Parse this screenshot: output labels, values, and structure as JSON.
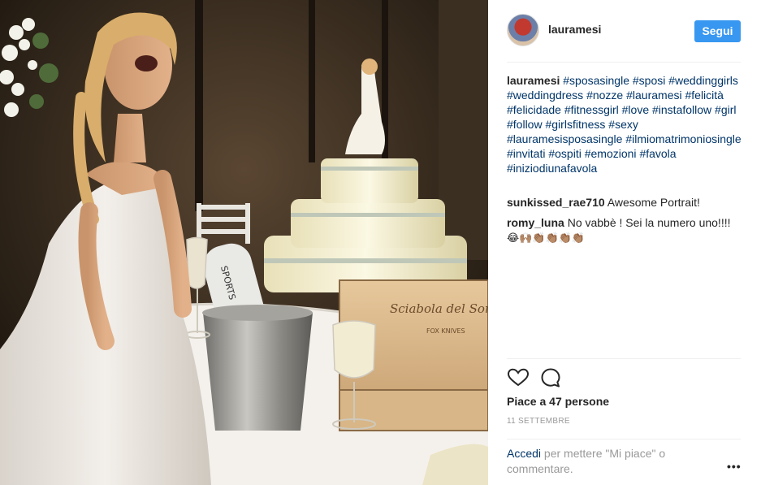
{
  "post": {
    "username": "lauramesi",
    "follow_label": "Segui",
    "caption_user": "lauramesi",
    "caption_hashtags": [
      "#sposasingle",
      "#sposi",
      "#weddinggirls",
      "#weddingdress",
      "#nozze",
      "#lauramesi",
      "#felicità",
      "#felicidade",
      "#fitnessgirl",
      "#love",
      "#instafollow",
      "#girl",
      "#follow",
      "#girlsfitness",
      "#sexy",
      "#lauramesisposasingle",
      "#ilmiomatrimoniosingle",
      "#invitati",
      "#ospiti",
      "#emozioni",
      "#favola",
      "#iniziodiunafavola"
    ],
    "comments": [
      {
        "user": "sunkissed_rae710",
        "text": "Awesome Portrait!"
      },
      {
        "user": "romy_luna",
        "text": "No vabbè ! Sei la numero uno!!!!",
        "emoji": "😂🙌🏽👏🏽👏🏽👏🏽👏🏽"
      }
    ],
    "likes": "Piace a 47 persone",
    "date": "11 SETTEMBRE",
    "login_link": "Accedi",
    "login_text": " per mettere \"Mi piace\" o commentare.",
    "more_label": "•••"
  },
  "photo": {
    "box_text_1": "Sciabola del Sommelier",
    "box_text_2": "FOX KNIVES",
    "bottle_label": "SPORTS"
  },
  "icons": {
    "heart": "heart-icon",
    "comment": "comment-icon",
    "more": "more-options-icon"
  },
  "colors": {
    "follow_button": "#3897f0",
    "link": "#003569",
    "muted": "#999999"
  }
}
